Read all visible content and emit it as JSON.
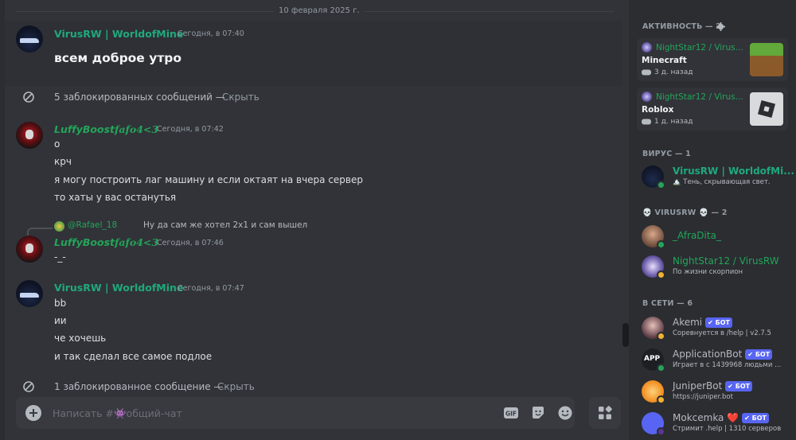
{
  "chat": {
    "date_divider": "10 февраля 2025 г.",
    "blocked_1": {
      "text": "5 заблокированных сообщений —",
      "link": "Скрыть"
    },
    "blocked_2": {
      "text": "1 заблокированное сообщение —",
      "link": "Скрыть"
    },
    "messages": [
      {
        "author": "VirusRW | WorldofMine",
        "time": "Сегодня, в 07:40",
        "lines": [
          "всем доброе утро"
        ]
      },
      {
        "author": "𝙇𝙪𝙛𝙛𝙮𝘽𝙤𝙤𝙨𝙩fafo4<3",
        "time": "Сегодня, в 07:42",
        "lines": [
          "о",
          "крч",
          "я могу построить лаг машину и если октаят на вчера сервер",
          "то хаты у вас останутья"
        ]
      },
      {
        "author": "𝙇𝙪𝙛𝙛𝙮𝘽𝙤𝙤𝙨𝙩fafo4<3",
        "time": "Сегодня, в 07:46",
        "lines": [
          "-_-"
        ],
        "reply": {
          "name": "@Rafael_18",
          "text": "Ну да сам же хотел 2х1 и сам вышел"
        }
      },
      {
        "author": "VirusRW | WorldofMine",
        "time": "Сегодня, в 07:47",
        "lines": [
          "bb",
          "ии",
          "че хочешь",
          "и так сделал все самое подлое"
        ]
      }
    ],
    "composer": {
      "placeholder": "Написать #👾общий-чат"
    }
  },
  "members": {
    "activity_title": "АКТИВНОСТЬ — 2",
    "activities": [
      {
        "name": "NightStar12 / Virus...",
        "game": "Minecraft",
        "time": "3 д. назад"
      },
      {
        "name": "NightStar12 / Virus...",
        "game": "Roblox",
        "time": "1 д. назад"
      }
    ],
    "group_virus": {
      "title": "ВИРУС — 1",
      "members": [
        {
          "name": "VirusRW | WorldofMi...",
          "sub": "🏔️ Тень, скрывающая свет."
        }
      ]
    },
    "group_virusrw": {
      "title": "💀 VIRUSRW 💀 — 2",
      "members": [
        {
          "name": "_AfraDita_",
          "sub": ""
        },
        {
          "name": "NightStar12 / VirusRW",
          "sub": "По жизни скорпион"
        }
      ]
    },
    "group_online": {
      "title": "В СЕТИ — 6",
      "members": [
        {
          "name": "Akemi",
          "badge": "✔ БОТ",
          "sub": "Соревнуется в /help | v2.7.5"
        },
        {
          "name": "ApplicationBot",
          "badge": "✔ БОТ",
          "sub": "Играет в с 1439968 людьми ..."
        },
        {
          "name": "JuniperBot",
          "badge": "✔ БОТ",
          "sub": "https://juniper.bot"
        },
        {
          "name": "Mokcemka ❤️",
          "badge": "✔ БОТ",
          "sub": "Стримит .help | 1310 серверов"
        }
      ]
    }
  },
  "colors": {
    "accent_green": "#23a559",
    "bot_tag": "#5865f2",
    "link": "#949ba4"
  }
}
